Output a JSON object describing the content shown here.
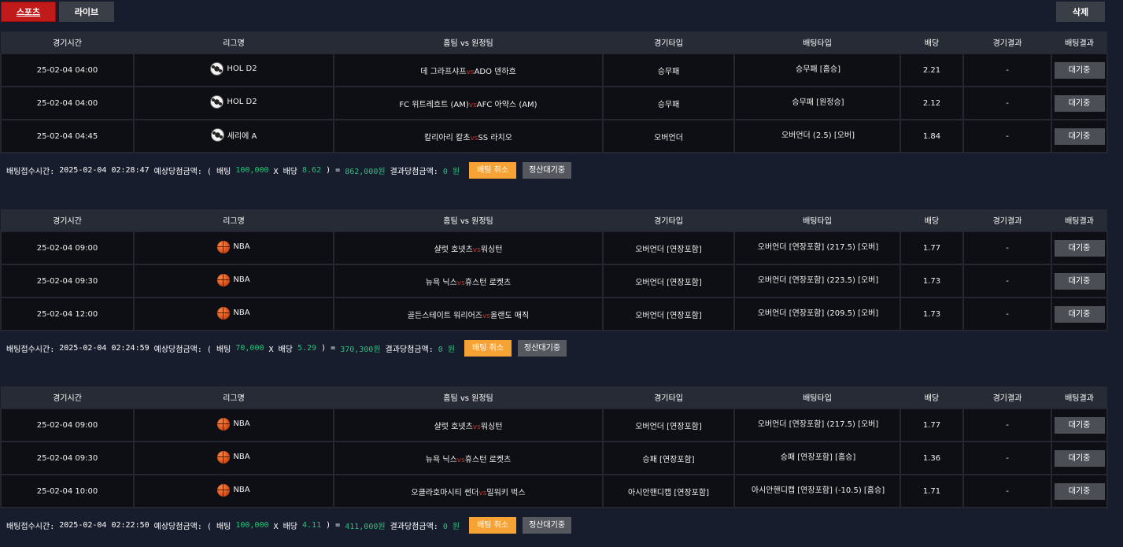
{
  "tabs": {
    "sports": "스포츠",
    "live": "라이브"
  },
  "delete_label": "삭제",
  "headers": [
    "경기시간",
    "리그명",
    "홈팀 vs 원정팀",
    "경기타입",
    "배팅타입",
    "배당",
    "경기결과",
    "배팅결과"
  ],
  "vs_text": "vs",
  "wait_label": "대기중",
  "cancel_label": "배팅 취소",
  "settle_label": "정산대기중",
  "summary_labels": {
    "received": "배팅접수시간: ",
    "expected": " 예상당첨금액: ( 배팅 ",
    "times_odds": " X 배당 ",
    "equals": " ) = ",
    "result": " 결과당첨금액: "
  },
  "bets": [
    {
      "rows": [
        {
          "time": "25-02-04 04:00",
          "sport": "soccer-icon",
          "league": "HOL D2",
          "home": "데 그라프샤프",
          "away": "ADO 덴하흐",
          "type": "승무패",
          "pick": "승무패 [홈승]",
          "odds": "2.21",
          "result": "-"
        },
        {
          "time": "25-02-04 04:00",
          "sport": "soccer-icon",
          "league": "HOL D2",
          "home": "FC 위트레흐트 (AM)",
          "away": "AFC 아약스 (AM)",
          "type": "승무패",
          "pick": "승무패 [원정승]",
          "odds": "2.12",
          "result": "-"
        },
        {
          "time": "25-02-04 04:45",
          "sport": "soccer-icon",
          "league": "세리에 A",
          "home": "칼리아리 칼초",
          "away": "SS 라치오",
          "type": "오버언더",
          "pick": "오버언더 (2.5) [오버]",
          "odds": "1.84",
          "result": "-"
        }
      ],
      "summary": {
        "time": "2025-02-04 02:28:47",
        "stake": "100,000",
        "odds": "8.62",
        "expected": "862,000원",
        "result": "0 원"
      }
    },
    {
      "rows": [
        {
          "time": "25-02-04 09:00",
          "sport": "basketball-icon",
          "league": "NBA",
          "home": "샬럿 호넷츠",
          "away": "워싱턴",
          "type": "오버언더 [연장포함]",
          "pick": "오버언더 [연장포함] (217.5) [오버]",
          "odds": "1.77",
          "result": "-"
        },
        {
          "time": "25-02-04 09:30",
          "sport": "basketball-icon",
          "league": "NBA",
          "home": "뉴욕 닉스",
          "away": "휴스턴 로켓츠",
          "type": "오버언더 [연장포함]",
          "pick": "오버언더 [연장포함] (223.5) [오버]",
          "odds": "1.73",
          "result": "-"
        },
        {
          "time": "25-02-04 12:00",
          "sport": "basketball-icon",
          "league": "NBA",
          "home": "골든스테이트 워리어즈",
          "away": "올랜도 매직",
          "type": "오버언더 [연장포함]",
          "pick": "오버언더 [연장포함] (209.5) [오버]",
          "odds": "1.73",
          "result": "-"
        }
      ],
      "summary": {
        "time": "2025-02-04 02:24:59",
        "stake": "70,000",
        "odds": "5.29",
        "expected": "370,300원",
        "result": "0 원"
      }
    },
    {
      "rows": [
        {
          "time": "25-02-04 09:00",
          "sport": "basketball-icon",
          "league": "NBA",
          "home": "샬럿 호넷츠",
          "away": "워싱턴",
          "type": "오버언더 [연장포함]",
          "pick": "오버언더 [연장포함] (217.5) [오버]",
          "odds": "1.77",
          "result": "-"
        },
        {
          "time": "25-02-04 09:30",
          "sport": "basketball-icon",
          "league": "NBA",
          "home": "뉴욕 닉스",
          "away": "휴스턴 로켓츠",
          "type": "승패 [연장포함]",
          "pick": "승패 [연장포함] [홈승]",
          "odds": "1.36",
          "result": "-"
        },
        {
          "time": "25-02-04 10:00",
          "sport": "basketball-icon",
          "league": "NBA",
          "home": "오클라호마시티 썬더",
          "away": "밀워키 벅스",
          "type": "아시안핸디캡 [연장포함]",
          "pick": "아시안핸디캡 [연장포함] (-10.5) [홈승]",
          "odds": "1.71",
          "result": "-"
        }
      ],
      "summary": {
        "time": "2025-02-04 02:22:50",
        "stake": "100,000",
        "odds": "4.11",
        "expected": "411,000원",
        "result": "0 원"
      }
    }
  ]
}
